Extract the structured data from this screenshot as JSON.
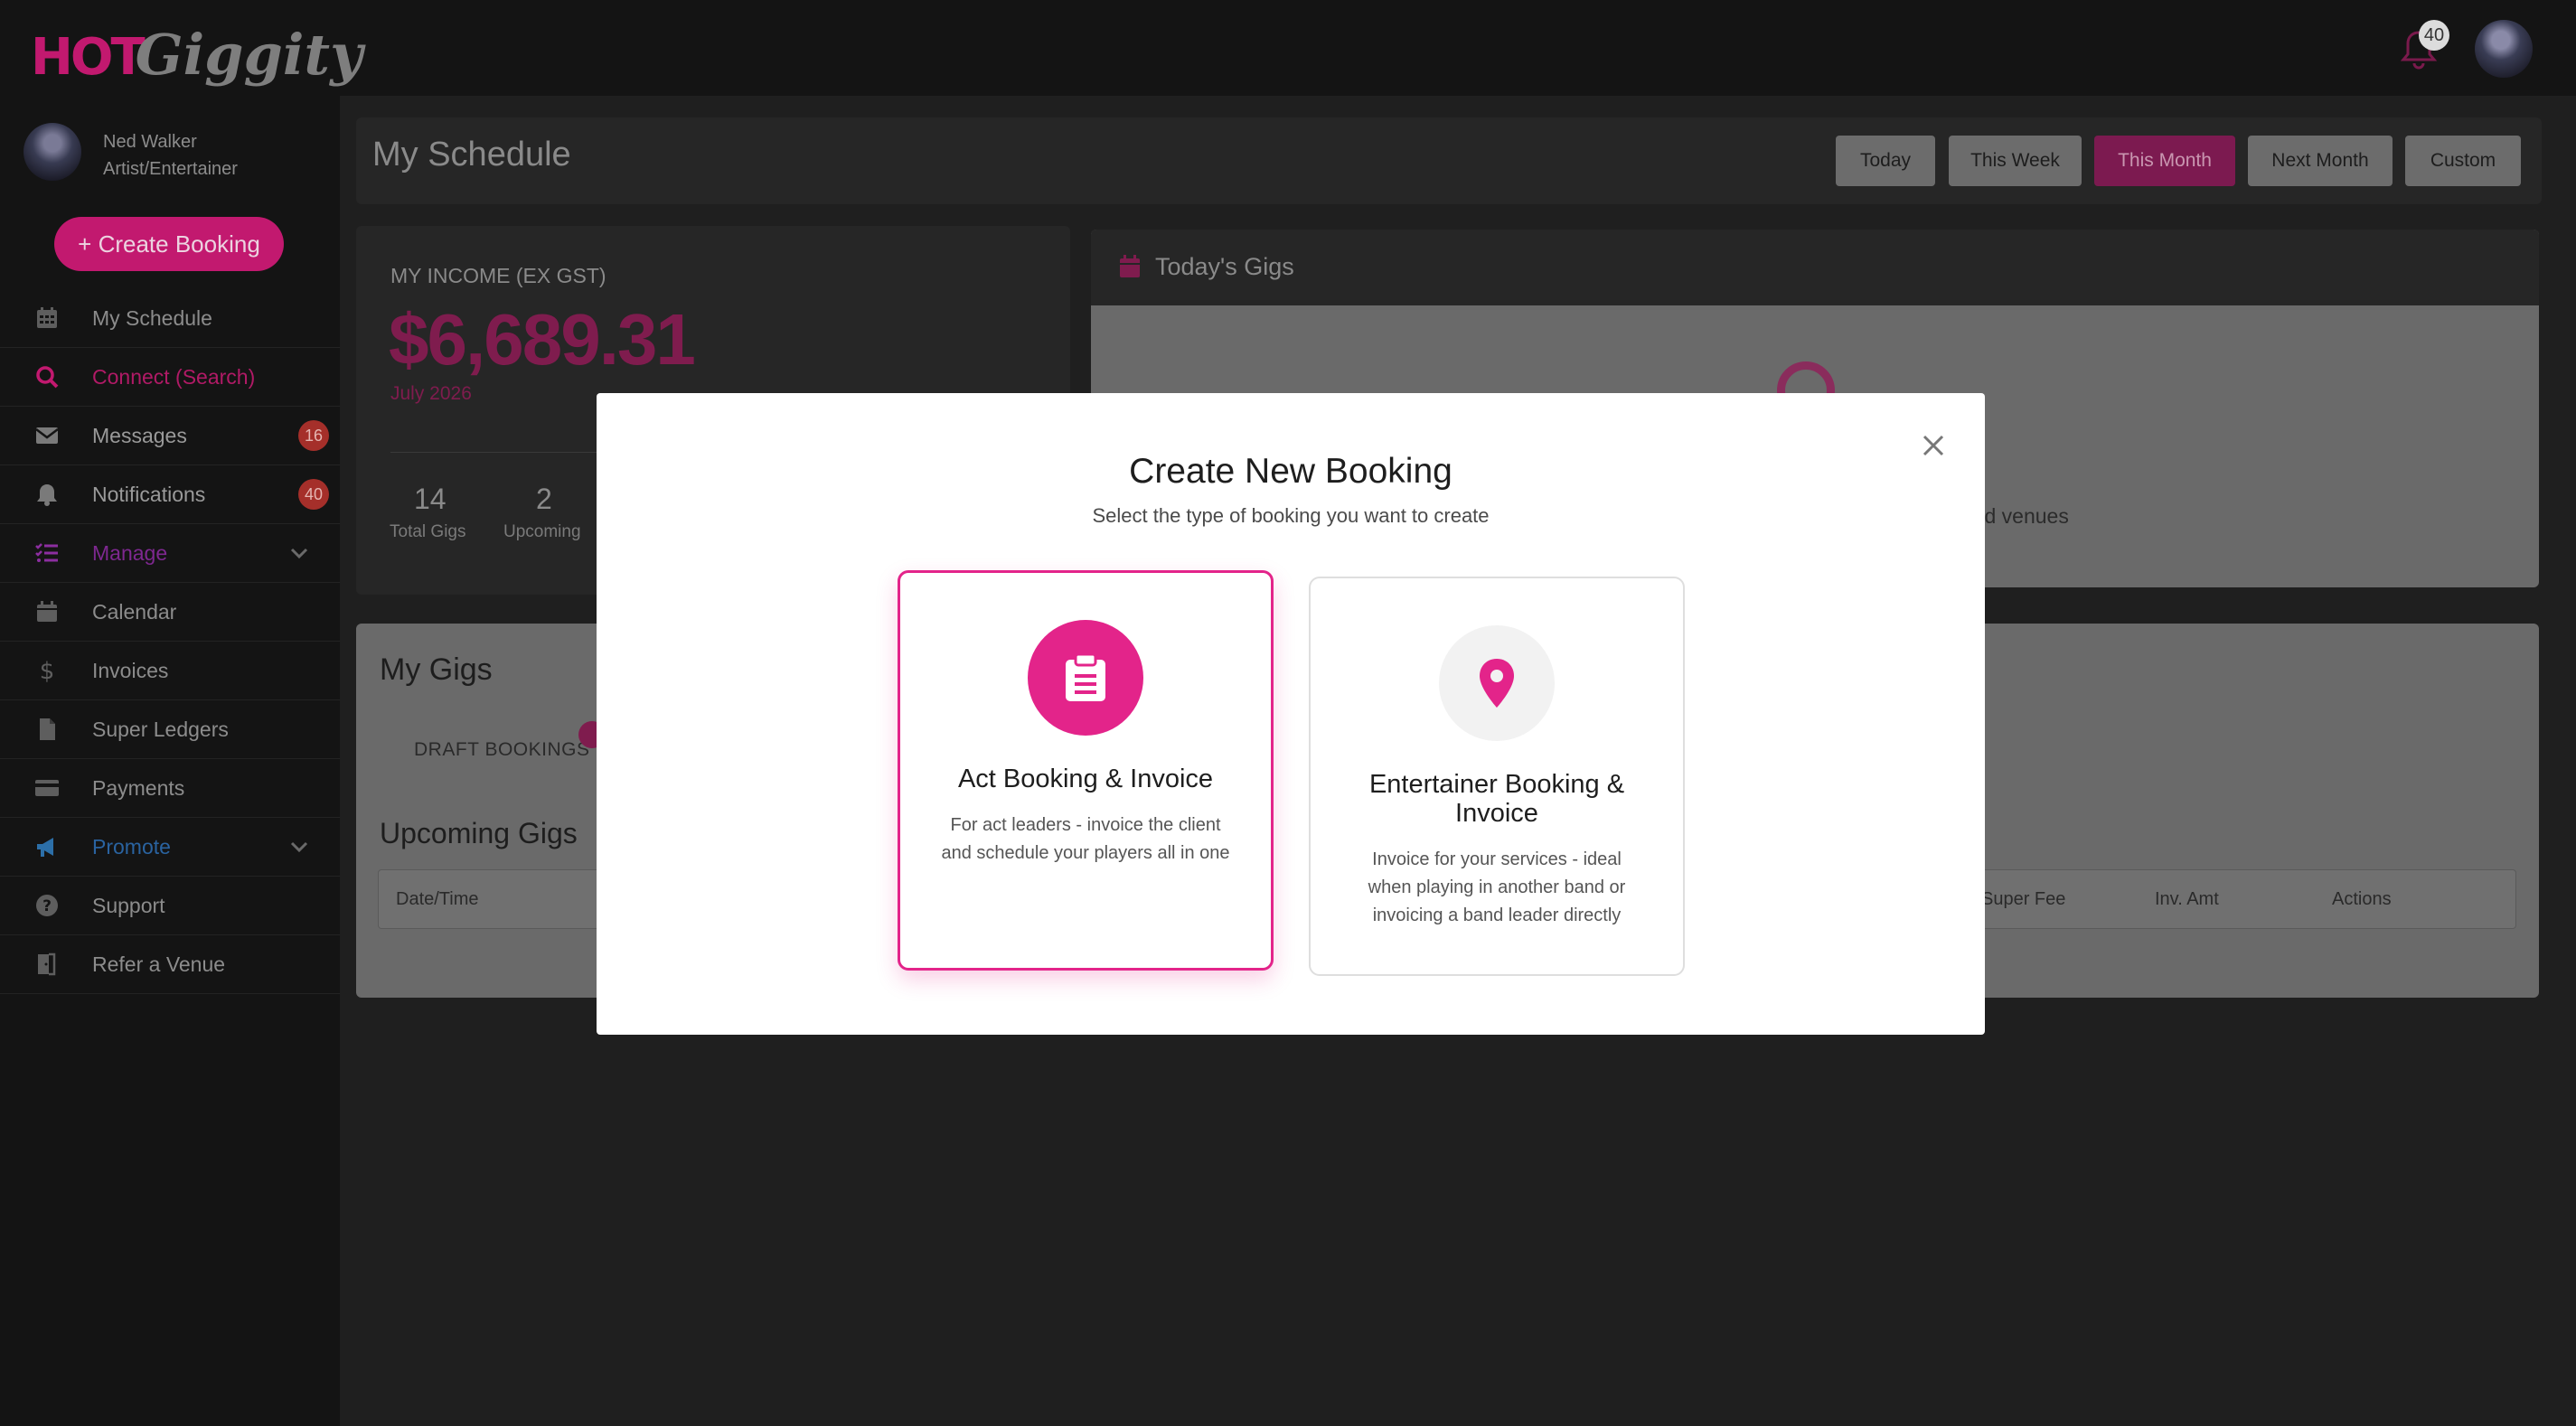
{
  "app": {
    "logo_hot": "HOT",
    "logo_giggity": "Giggity",
    "notification_count": "40"
  },
  "user": {
    "name": "Ned Walker",
    "role": "Artist/Entertainer"
  },
  "sidebar": {
    "create_button": "+ Create Booking",
    "items": [
      {
        "label": "My Schedule",
        "icon": "calendar-grid-icon"
      },
      {
        "label": "Connect (Search)",
        "icon": "search-icon",
        "color": "#c2196f"
      },
      {
        "label": "Messages",
        "icon": "envelope-icon",
        "badge": "16"
      },
      {
        "label": "Notifications",
        "icon": "bell-icon",
        "badge": "40"
      },
      {
        "label": "Manage",
        "icon": "checklist-icon",
        "color": "#8c2ea0",
        "expandable": true
      },
      {
        "label": "Calendar",
        "icon": "calendar-icon"
      },
      {
        "label": "Invoices",
        "icon": "dollar-icon"
      },
      {
        "label": "Super Ledgers",
        "icon": "document-icon"
      },
      {
        "label": "Payments",
        "icon": "credit-card-icon"
      },
      {
        "label": "Promote",
        "icon": "megaphone-icon",
        "color": "#2c6fa8",
        "expandable": true
      },
      {
        "label": "Support",
        "icon": "question-circle-icon"
      },
      {
        "label": "Refer a Venue",
        "icon": "door-icon"
      }
    ]
  },
  "schedule": {
    "title": "My Schedule",
    "ranges": [
      "Today",
      "This Week",
      "This Month",
      "Next Month",
      "Custom"
    ],
    "active_range": "This Month"
  },
  "income": {
    "label": "MY INCOME (EX GST)",
    "amount": "$6,689.31",
    "period": "July 2026",
    "total_gigs": "14",
    "total_gigs_label": "Total Gigs",
    "upcoming": "2",
    "upcoming_label": "Upcoming"
  },
  "todays_gigs": {
    "title": "Today's Gigs",
    "empty_text_fragment": "s and venues"
  },
  "my_gigs": {
    "title": "My Gigs",
    "draft_tab": "DRAFT BOOKINGS",
    "upcoming_title": "Upcoming Gigs",
    "columns": [
      "Date/Time",
      "Super Fee",
      "Inv. Amt",
      "Actions"
    ]
  },
  "modal": {
    "title": "Create New Booking",
    "subtitle": "Select the type of booking you want to create",
    "options": [
      {
        "title": "Act Booking & Invoice",
        "description": "For act leaders - invoice the client and schedule your players all in one",
        "icon": "clipboard-icon",
        "selected": true
      },
      {
        "title": "Entertainer Booking & Invoice",
        "description": "Invoice for your services - ideal when playing in another band or invoicing a band leader directly",
        "icon": "map-pin-icon",
        "selected": false
      }
    ]
  },
  "colors": {
    "brand_pink": "#e3248a",
    "brand_dim": "#c2196f",
    "badge_red": "#a52f2a"
  }
}
